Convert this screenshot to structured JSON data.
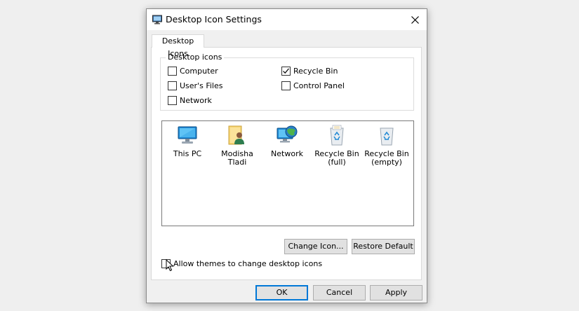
{
  "window": {
    "title": "Desktop Icon Settings",
    "close_glyph": "✕"
  },
  "tabs": [
    {
      "label": "Desktop Icons"
    }
  ],
  "desktop_icons_group": {
    "legend": "Desktop icons",
    "checkboxes": [
      {
        "label": "Computer",
        "checked": false
      },
      {
        "label": "User's Files",
        "checked": false
      },
      {
        "label": "Network",
        "checked": false
      },
      {
        "label": "Recycle Bin",
        "checked": true
      },
      {
        "label": "Control Panel",
        "checked": false
      }
    ]
  },
  "icon_list": {
    "items": [
      {
        "label": "This PC",
        "icon": "monitor-icon"
      },
      {
        "label": "Modisha Tladi",
        "icon": "user-folder-icon"
      },
      {
        "label": "Network",
        "icon": "network-globe-icon"
      },
      {
        "label": "Recycle Bin\n(full)",
        "icon": "recycle-bin-full-icon"
      },
      {
        "label": "Recycle Bin\n(empty)",
        "icon": "recycle-bin-empty-icon"
      }
    ]
  },
  "buttons": {
    "change_icon": "Change Icon...",
    "restore_default": "Restore Default",
    "ok": "OK",
    "cancel": "Cancel",
    "apply": "Apply"
  },
  "themes_checkbox": {
    "label": "Allow themes to change desktop icons",
    "checked": false
  },
  "colors": {
    "accent": "#0078d7",
    "button_face": "#e1e1e1",
    "dialog_bg": "#f0f0f0"
  }
}
